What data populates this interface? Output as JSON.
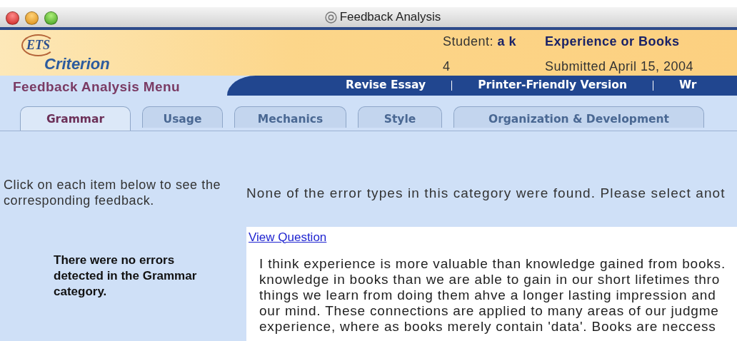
{
  "window": {
    "title": "Feedback Analysis"
  },
  "header": {
    "logo_mark": "ETS",
    "logo_text": "Criterion",
    "student": "Student: **a k**",
    "score": "4",
    "prompt_title": "Experience or Books",
    "submitted": "Submitted April 15, 2004"
  },
  "menu": {
    "title": "Feedback Analysis Menu",
    "links": [
      "Revise Essay",
      "Printer-Friendly Version",
      "Wr"
    ]
  },
  "tabs": [
    {
      "label": "Grammar",
      "selected": true
    },
    {
      "label": "Usage",
      "selected": false
    },
    {
      "label": "Mechanics",
      "selected": false
    },
    {
      "label": "Style",
      "selected": false
    },
    {
      "label": "Organization & Development",
      "selected": false
    }
  ],
  "sidebar": {
    "instructions": "Click on each item below to see the corresponding feedback.",
    "notice": "There were no errors detected in the Grammar category."
  },
  "main": {
    "message": "None of the error types in this category were found. Please select anot",
    "link": "View Question",
    "essay_lines": [
      "I think experience is more valuable than knowledge gained from books.",
      "knowledge in books than we are able to gain in our short lifetimes thro",
      "things we learn from doing them ahve a longer lasting impression and",
      "our mind. These connections are applied to many areas of our judgme",
      "experience, where as books merely contain 'data'. Books are neccess"
    ]
  }
}
